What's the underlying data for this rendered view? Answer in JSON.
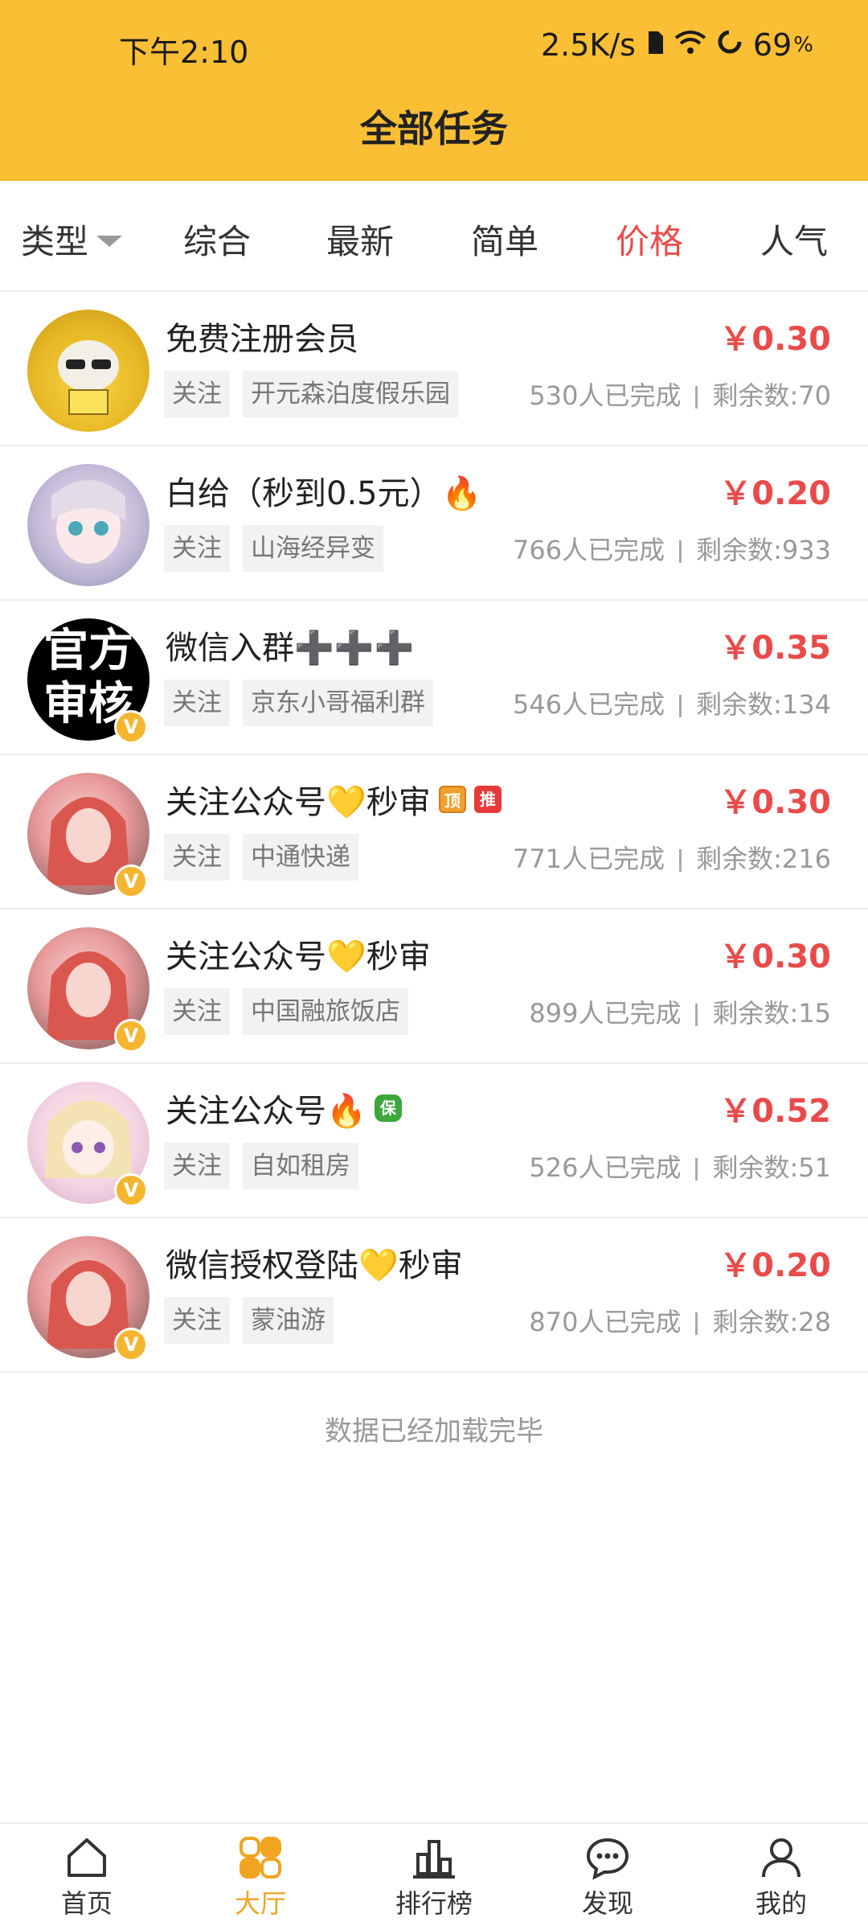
{
  "status_bar": {
    "time": "下午2:10",
    "speed": "2.5K/s",
    "battery": "69",
    "battery_unit": "%"
  },
  "page_title": "全部任务",
  "filter_tabs": {
    "type_label": "类型",
    "tabs": [
      "综合",
      "最新",
      "简单",
      "价格",
      "人气"
    ],
    "active": "价格"
  },
  "tasks": [
    {
      "title": "免费注册会员",
      "price": "￥0.30",
      "follow_label": "关注",
      "merchant": "开元森泊度假乐园",
      "completed": "530人已完成",
      "remaining": "剩余数:70"
    },
    {
      "title": "白给（秒到0.5元）🔥",
      "price": "￥0.20",
      "follow_label": "关注",
      "merchant": "山海经异变",
      "completed": "766人已完成",
      "remaining": "剩余数:933"
    },
    {
      "title": "微信入群➕➕➕",
      "price": "￥0.35",
      "follow_label": "关注",
      "merchant": "京东小哥福利群",
      "completed": "546人已完成",
      "remaining": "剩余数:134",
      "avatar_text": "官方审核"
    },
    {
      "title": "关注公众号💛秒审",
      "price": "￥0.30",
      "follow_label": "关注",
      "merchant": "中通快递",
      "completed": "771人已完成",
      "remaining": "剩余数:216",
      "badge_top": "顶",
      "badge_rec": "推"
    },
    {
      "title": "关注公众号💛秒审",
      "price": "￥0.30",
      "follow_label": "关注",
      "merchant": "中国融旅饭店",
      "completed": "899人已完成",
      "remaining": "剩余数:15"
    },
    {
      "title": "关注公众号🔥",
      "price": "￥0.52",
      "follow_label": "关注",
      "merchant": "自如租房",
      "completed": "526人已完成",
      "remaining": "剩余数:51",
      "badge_bao": "保"
    },
    {
      "title": "微信授权登陆💛秒审",
      "price": "￥0.20",
      "follow_label": "关注",
      "merchant": "蒙油游",
      "completed": "870人已完成",
      "remaining": "剩余数:28"
    }
  ],
  "verified_badge": "V",
  "end_note": "数据已经加载完毕",
  "bottom_nav": {
    "items": [
      {
        "label": "首页",
        "icon": "home-icon"
      },
      {
        "label": "大厅",
        "icon": "grid-icon"
      },
      {
        "label": "排行榜",
        "icon": "ranking-icon"
      },
      {
        "label": "发现",
        "icon": "chat-icon"
      },
      {
        "label": "我的",
        "icon": "user-icon"
      }
    ],
    "active": "大厅"
  },
  "colors": {
    "header": "#fbbf35",
    "accent_red": "#e94b4b",
    "nav_active": "#f0a422"
  }
}
